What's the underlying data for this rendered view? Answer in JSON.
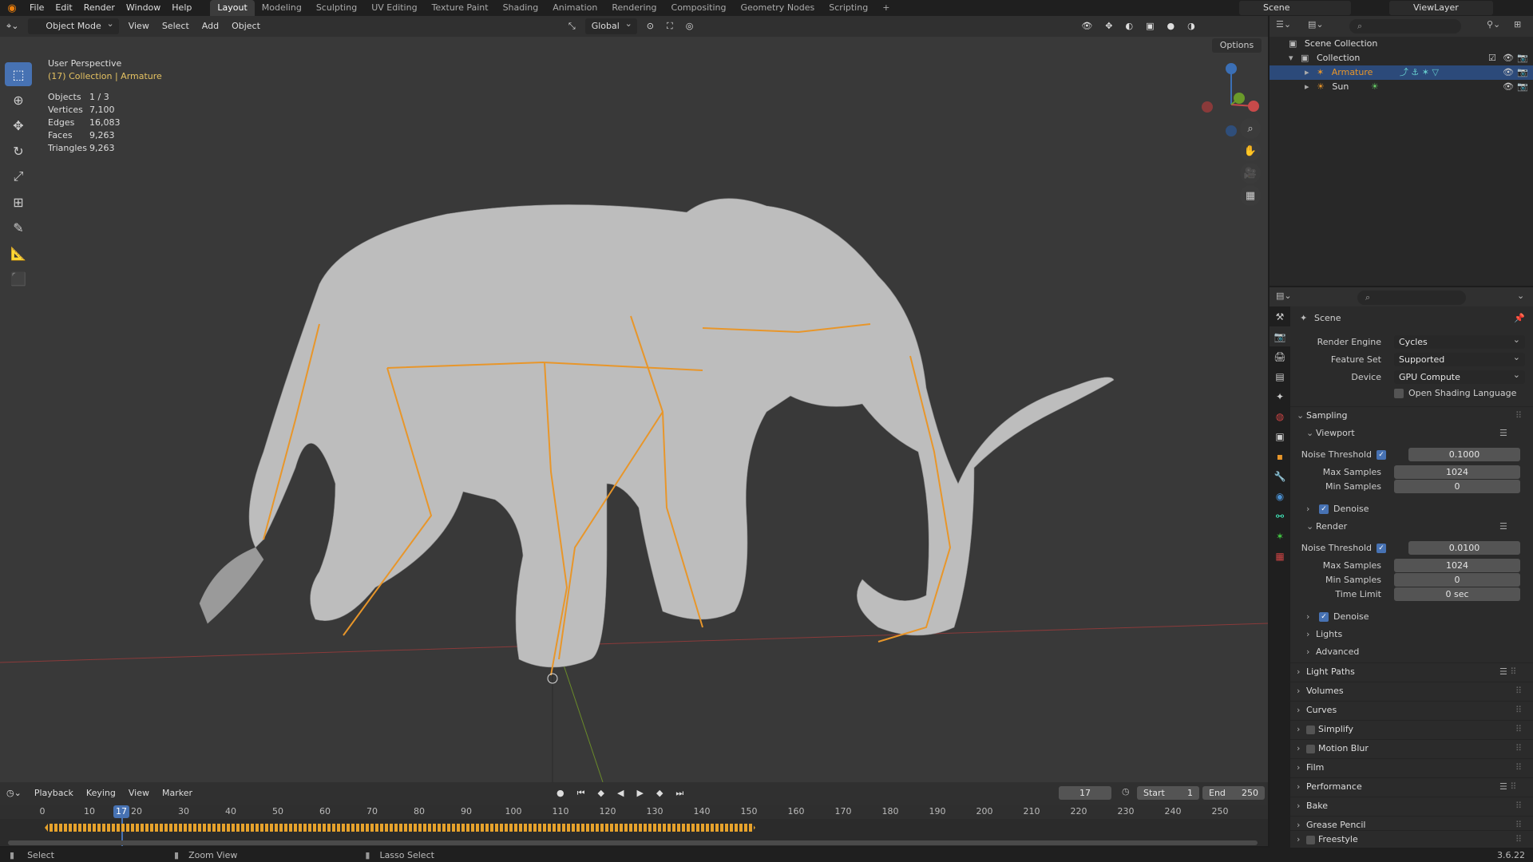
{
  "topbar": {
    "menus": [
      "File",
      "Edit",
      "Render",
      "Window",
      "Help"
    ],
    "workspaces": [
      "Layout",
      "Modeling",
      "Sculpting",
      "UV Editing",
      "Texture Paint",
      "Shading",
      "Animation",
      "Rendering",
      "Compositing",
      "Geometry Nodes",
      "Scripting"
    ],
    "active_workspace": "Layout",
    "add_tab": "+",
    "scene": "Scene",
    "view_layer": "ViewLayer"
  },
  "viewport_header": {
    "mode": "Object Mode",
    "menus": [
      "View",
      "Select",
      "Add",
      "Object"
    ],
    "transform": "Global",
    "options": "Options"
  },
  "overlay": {
    "view": "User Perspective",
    "collection": "(17) Collection | Armature",
    "stats": [
      {
        "label": "Objects",
        "value": "1 / 3"
      },
      {
        "label": "Vertices",
        "value": "7,100"
      },
      {
        "label": "Edges",
        "value": "16,083"
      },
      {
        "label": "Faces",
        "value": "9,263"
      },
      {
        "label": "Triangles",
        "value": "9,263"
      }
    ]
  },
  "timeline": {
    "menus": [
      "Playback",
      "Keying",
      "View",
      "Marker"
    ],
    "current_frame": "17",
    "start_label": "Start",
    "start": "1",
    "end_label": "End",
    "end": "250",
    "ticks": [
      "0",
      "10",
      "20",
      "30",
      "40",
      "50",
      "60",
      "70",
      "80",
      "90",
      "100",
      "110",
      "120",
      "130",
      "140",
      "150",
      "160",
      "170",
      "180",
      "190",
      "200",
      "210",
      "220",
      "230",
      "240",
      "250"
    ]
  },
  "status": {
    "select": "Select",
    "zoom": "Zoom View",
    "lasso": "Lasso Select",
    "version": "3.6.22"
  },
  "outliner": {
    "root": "Scene Collection",
    "collection": "Collection",
    "items": [
      "Armature",
      "Sun"
    ]
  },
  "properties": {
    "title": "Scene",
    "render_engine_label": "Render Engine",
    "render_engine": "Cycles",
    "feature_set_label": "Feature Set",
    "feature_set": "Supported",
    "device_label": "Device",
    "device": "GPU Compute",
    "osl": "Open Shading Language",
    "sampling": "Sampling",
    "viewport": "Viewport",
    "noise_threshold_label": "Noise Threshold",
    "vp_noise": "0.1000",
    "max_samples_label": "Max Samples",
    "vp_max": "1024",
    "min_samples_label": "Min Samples",
    "vp_min": "0",
    "denoise": "Denoise",
    "render": "Render",
    "r_noise": "0.0100",
    "r_max": "1024",
    "r_min": "0",
    "time_limit_label": "Time Limit",
    "r_time": "0 sec",
    "lights": "Lights",
    "advanced": "Advanced",
    "sections": [
      "Light Paths",
      "Volumes",
      "Curves",
      "Simplify",
      "Motion Blur",
      "Film",
      "Performance",
      "Bake",
      "Grease Pencil",
      "Freestyle"
    ]
  }
}
